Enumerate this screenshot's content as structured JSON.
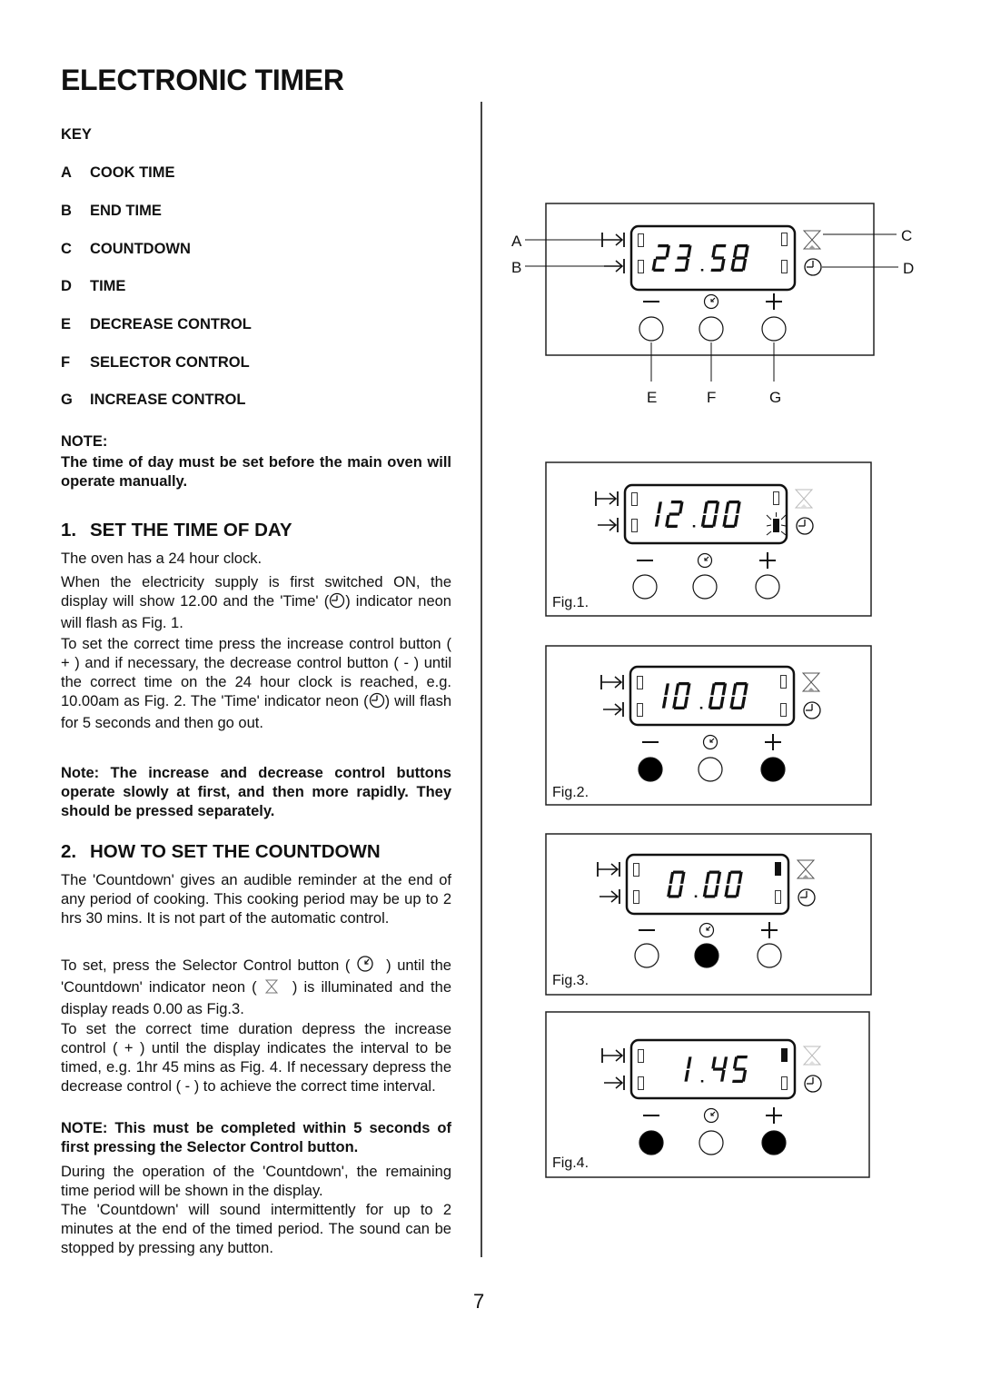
{
  "page": {
    "title": "ELECTRONIC TIMER",
    "page_number": "7"
  },
  "key": {
    "heading": "KEY",
    "items": [
      {
        "letter": "A",
        "label": "COOK TIME"
      },
      {
        "letter": "B",
        "label": "END TIME"
      },
      {
        "letter": "C",
        "label": "COUNTDOWN"
      },
      {
        "letter": "D",
        "label": "TIME"
      },
      {
        "letter": "E",
        "label": "DECREASE CONTROL"
      },
      {
        "letter": "F",
        "label": "SELECTOR CONTROL"
      },
      {
        "letter": "G",
        "label": "INCREASE CONTROL"
      }
    ]
  },
  "note": {
    "heading": "NOTE:",
    "text": "The time of day must be set before the main oven will operate manually."
  },
  "section1": {
    "number": "1.",
    "heading": "SET THE TIME OF DAY",
    "p1": "The oven has a 24 hour clock.",
    "p2_a": "When the electricity supply is first switched ON, the display will show 12.00 and the 'Time' (",
    "p2_b": ") indicator neon will flash as Fig. 1.",
    "p3_a": "To set the correct time press the increase control button ( + ) and if necessary, the decrease control button ( - ) until the correct time on the 24 hour clock is reached,  e.g. 10.00am as Fig. 2.  The 'Time' indicator neon (",
    "p3_b": ") will flash for 5 seconds and then go out.",
    "note": "Note: The increase and decrease control buttons operate slowly at first, and then more rapidly. They should be pressed separately."
  },
  "section2": {
    "number": "2.",
    "heading": "HOW TO SET THE COUNTDOWN",
    "p1": "The 'Countdown' gives an audible reminder at the end of any period of cooking. This cooking period may be up to 2 hrs 30 mins. It is not part of the automatic control.",
    "p2_a": "To set, press the Selector Control button (",
    "p2_b": ") until the 'Countdown' indicator neon (",
    "p2_c": ") is illuminated and the display reads 0.00 as Fig.3.",
    "p3": "To set the correct time duration depress the increase control ( + ) until the display indicates the interval to be timed, e.g. 1hr 45 mins as Fig. 4.  If necessary depress the decrease control ( - ) to achieve the correct time interval.",
    "note": "NOTE:  This must be completed within 5 seconds of first pressing the Selector Control button.",
    "p4": "During the operation of the 'Countdown', the remaining time period will be shown in the display.",
    "p5": "The 'Countdown' will sound intermittently for up to 2 minutes at the end of the timed period.  The sound can be stopped by pressing any button."
  },
  "figures": [
    {
      "id": "key-diagram",
      "caption": "",
      "display": "23.58",
      "callouts": {
        "a": "A",
        "b": "B",
        "c": "C",
        "d": "D",
        "e": "E",
        "f": "F",
        "g": "G"
      },
      "indicators": {
        "cook_time": "off",
        "end_time": "off",
        "countdown": "off",
        "time": "off"
      },
      "countdown_icon": "hourglass-icon",
      "buttons": {
        "decrease": "released",
        "selector": "released",
        "increase": "released"
      },
      "button_symbols": {
        "decrease": "−",
        "increase": "+"
      }
    },
    {
      "id": "fig1",
      "caption": "Fig.1.",
      "display": "12.00",
      "indicators": {
        "cook_time": "off",
        "end_time": "off",
        "countdown": "off",
        "time": "flashing"
      },
      "countdown_icon": "faded-hourglass-icon",
      "buttons": {
        "decrease": "released",
        "selector": "released",
        "increase": "released"
      },
      "button_symbols": {
        "decrease": "−",
        "increase": "+"
      }
    },
    {
      "id": "fig2",
      "caption": "Fig.2.",
      "display": "10.00",
      "indicators": {
        "cook_time": "off",
        "end_time": "off",
        "countdown": "off",
        "time": "off"
      },
      "countdown_icon": "hourglass-icon",
      "buttons": {
        "decrease": "pressed",
        "selector": "released",
        "increase": "pressed"
      },
      "button_symbols": {
        "decrease": "−",
        "increase": "+"
      }
    },
    {
      "id": "fig3",
      "caption": "Fig.3.",
      "display": "0.00",
      "indicators": {
        "cook_time": "off",
        "end_time": "off",
        "countdown": "on",
        "time": "off"
      },
      "countdown_icon": "hourglass-icon",
      "buttons": {
        "decrease": "released",
        "selector": "pressed",
        "increase": "released"
      },
      "button_symbols": {
        "decrease": "−",
        "increase": "+"
      }
    },
    {
      "id": "fig4",
      "caption": "Fig.4.",
      "display": "1.45",
      "indicators": {
        "cook_time": "off",
        "end_time": "off",
        "countdown": "on",
        "time": "off"
      },
      "countdown_icon": "faded-hourglass-icon",
      "buttons": {
        "decrease": "pressed",
        "selector": "released",
        "increase": "pressed"
      },
      "button_symbols": {
        "decrease": "−",
        "increase": "+"
      }
    }
  ]
}
